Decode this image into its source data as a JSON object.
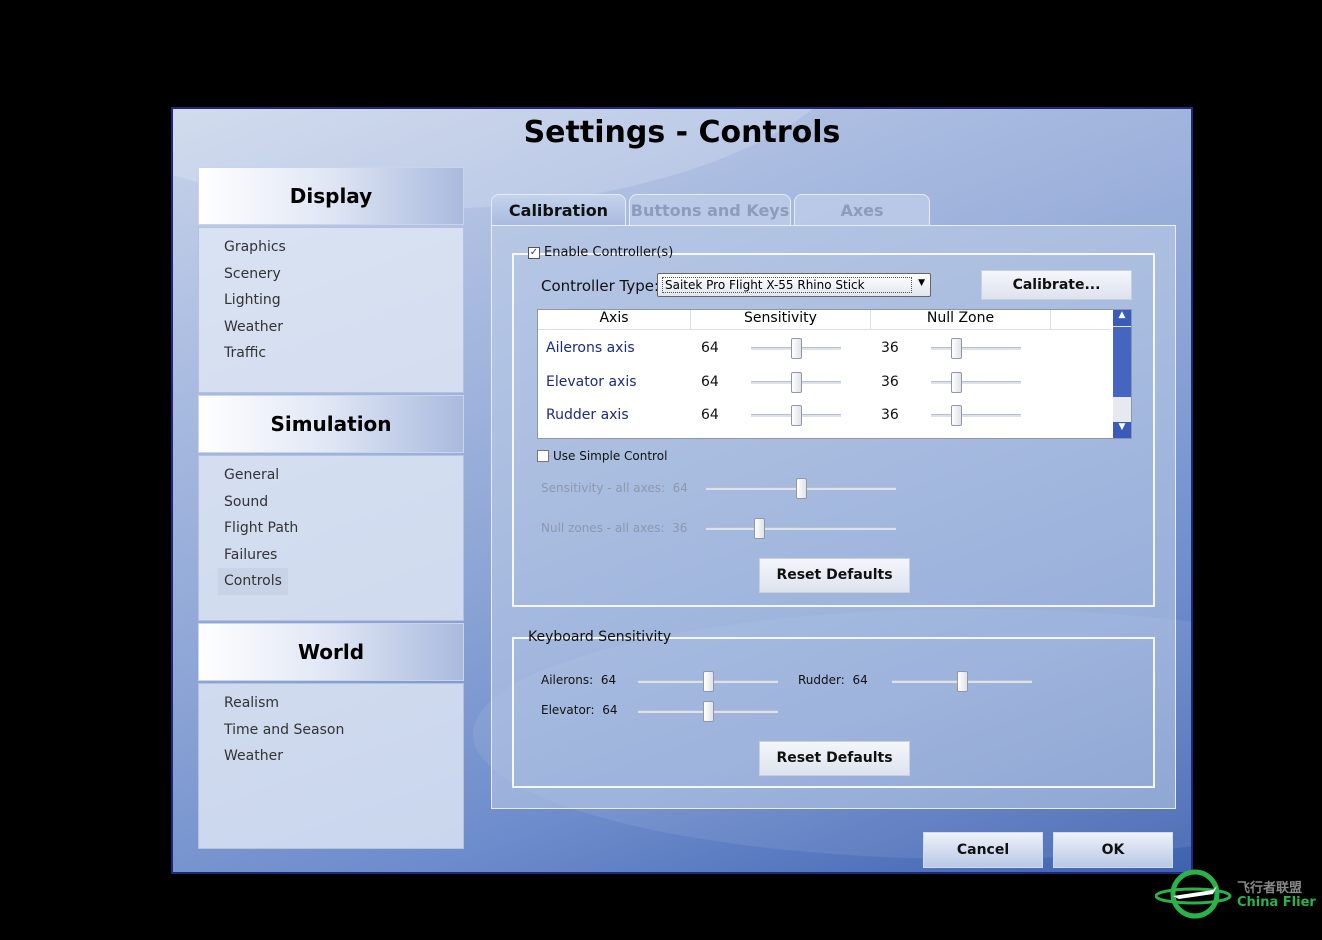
{
  "window": {
    "title": "Settings - Controls"
  },
  "sidebar": [
    {
      "header": "Display",
      "items": [
        "Graphics",
        "Scenery",
        "Lighting",
        "Weather",
        "Traffic"
      ]
    },
    {
      "header": "Simulation",
      "items": [
        "General",
        "Sound",
        "Flight Path",
        "Failures",
        "Controls"
      ],
      "selected": "Controls"
    },
    {
      "header": "World",
      "items": [
        "Realism",
        "Time and Season",
        "Weather"
      ]
    }
  ],
  "tabs": [
    {
      "label": "Calibration",
      "active": true
    },
    {
      "label": "Buttons and Keys"
    },
    {
      "label": "Axes"
    }
  ],
  "calibration": {
    "enable_label": "Enable Controller(s)",
    "enable_checked": true,
    "controller_type_label": "Controller Type:",
    "controller_type_value": "Saitek Pro Flight X-55 Rhino Stick",
    "calibrate_label": "Calibrate...",
    "columns": [
      "Axis",
      "Sensitivity",
      "Null Zone"
    ],
    "rows": [
      {
        "axis": "Ailerons axis",
        "sensitivity": 64,
        "null_zone": 36
      },
      {
        "axis": "Elevator axis",
        "sensitivity": 64,
        "null_zone": 36
      },
      {
        "axis": "Rudder axis",
        "sensitivity": 64,
        "null_zone": 36
      }
    ],
    "simple_label": "Use Simple Control",
    "simple_checked": false,
    "sens_all_label": "Sensitivity - all axes:",
    "sens_all_value": "64",
    "null_all_label": "Null zones - all axes:",
    "null_all_value": "36",
    "reset_label": "Reset Defaults"
  },
  "keyboard": {
    "title": "Keyboard Sensitivity",
    "ailerons_label": "Ailerons:",
    "ailerons_value": "64",
    "rudder_label": "Rudder:",
    "rudder_value": "64",
    "elevator_label": "Elevator:",
    "elevator_value": "64",
    "reset_label": "Reset Defaults"
  },
  "buttons": {
    "cancel": "Cancel",
    "ok": "OK"
  },
  "watermark": {
    "text_cn": "飞行者联盟",
    "text_en": "China Flier",
    "color": "#2bb34a"
  },
  "colors": {
    "accent": "#1c2a7a",
    "row_text": "#1a2a8a"
  }
}
